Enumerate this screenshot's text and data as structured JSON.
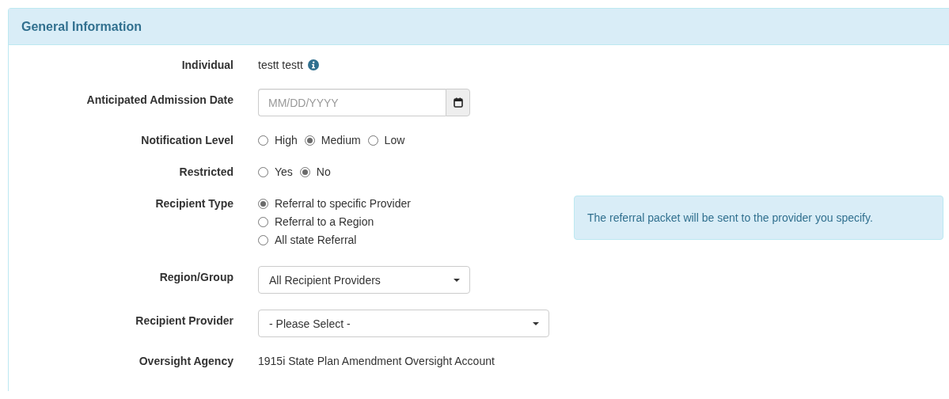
{
  "panel": {
    "title": "General Information"
  },
  "fields": [
    {
      "kind": "text",
      "label": "Individual",
      "value": "testt testt",
      "info": true
    },
    {
      "kind": "date",
      "label": "Anticipated Admission Date",
      "placeholder": "MM/DD/YYYY"
    },
    {
      "kind": "radiorow",
      "label": "Notification Level",
      "options": [
        {
          "label": "High",
          "selected": false
        },
        {
          "label": "Medium",
          "selected": true
        },
        {
          "label": "Low",
          "selected": false
        }
      ]
    },
    {
      "kind": "radiorow",
      "label": "Restricted",
      "options": [
        {
          "label": "Yes",
          "selected": false
        },
        {
          "label": "No",
          "selected": true
        }
      ]
    },
    {
      "kind": "radiolist",
      "label": "Recipient Type",
      "options": [
        {
          "label": "Referral to specific Provider",
          "selected": true
        },
        {
          "label": "Referral to a Region",
          "selected": false
        },
        {
          "label": "All state Referral",
          "selected": false
        }
      ],
      "note": "The referral packet will be sent to the provider you specify."
    },
    {
      "kind": "select",
      "label": "Region/Group",
      "value": "All Recipient Providers"
    },
    {
      "kind": "wideselect",
      "label": "Recipient Provider",
      "value": "- Please Select -"
    },
    {
      "kind": "text",
      "label": "Oversight Agency",
      "value": "1915i State Plan Amendment Oversight Account"
    }
  ]
}
